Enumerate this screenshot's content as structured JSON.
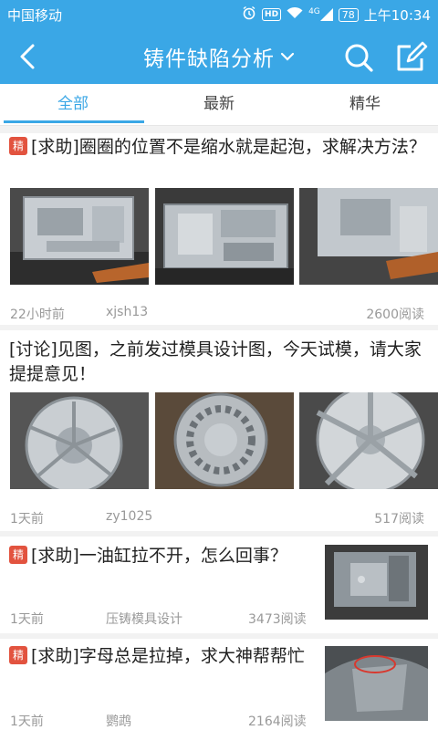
{
  "status_bar": {
    "carrier": "中国移动",
    "alarm_icon": "alarm-icon",
    "hd": "HD",
    "wifi_icon": "wifi-icon",
    "signal": "4G",
    "battery": "78",
    "time": "上午10:34"
  },
  "nav": {
    "title": "铸件缺陷分析",
    "back_icon": "chevron-left-icon",
    "dropdown_icon": "chevron-down-icon",
    "search_icon": "search-icon",
    "compose_icon": "compose-icon",
    "color": "#3aa7e6"
  },
  "tabs": [
    {
      "label": "全部",
      "active": true
    },
    {
      "label": "最新",
      "active": false
    },
    {
      "label": "精华",
      "active": false
    }
  ],
  "posts": [
    {
      "badge": "精",
      "title": "[求助]圈圈的位置不是缩水就是起泡，求解决方法？",
      "time": "22小时前",
      "author": "xjsh13",
      "reads": "2600阅读"
    },
    {
      "badge": "",
      "title": "[讨论]见图，之前发过模具设计图，今天试模，请大家提提意见！",
      "time": "1天前",
      "author": "zy1025",
      "reads": "517阅读"
    },
    {
      "badge": "精",
      "title": "[求助]一油缸拉不开，怎么回事？",
      "time": "1天前",
      "author": "压铸模具设计",
      "reads": "3473阅读"
    },
    {
      "badge": "精",
      "title": "[求助]字母总是拉掉，求大神帮帮忙",
      "time": "1天前",
      "author": "鹦鹉",
      "reads": "2164阅读"
    }
  ],
  "colors": {
    "badge": "#e2533f",
    "meta": "#999999"
  }
}
